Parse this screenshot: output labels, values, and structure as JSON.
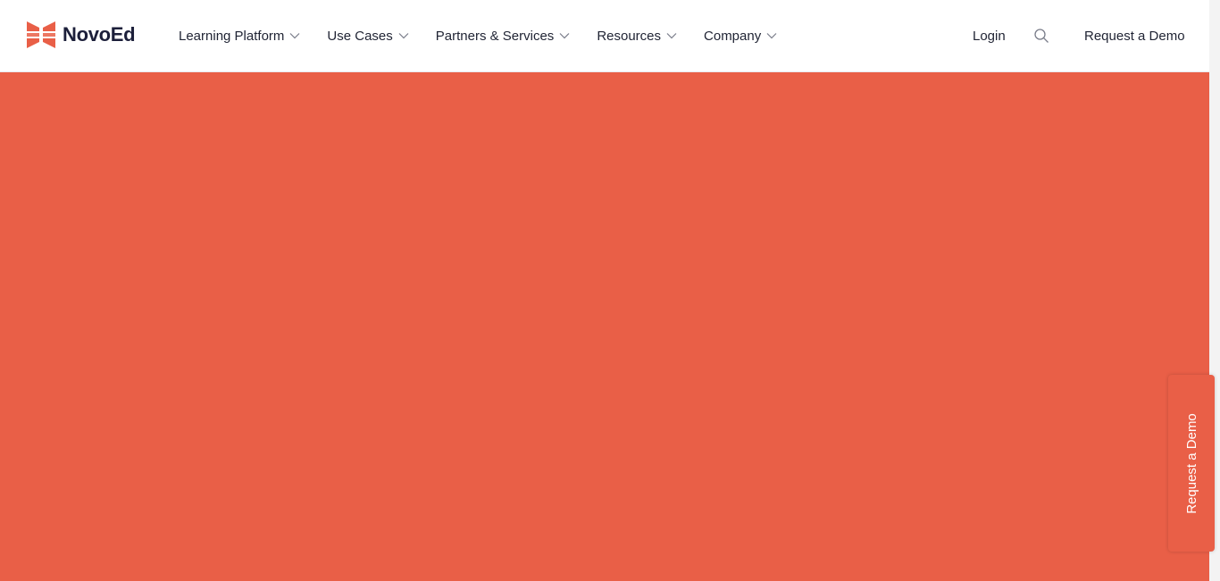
{
  "brand": {
    "name": "NovoEd",
    "accent_color": "#e95f47",
    "icon": "novoed-logo-icon"
  },
  "nav": {
    "items": [
      {
        "label": "Learning Platform",
        "icon": "chevron-down-icon"
      },
      {
        "label": "Use Cases",
        "icon": "chevron-down-icon"
      },
      {
        "label": "Partners & Services",
        "icon": "chevron-down-icon"
      },
      {
        "label": "Resources",
        "icon": "chevron-down-icon"
      },
      {
        "label": "Company",
        "icon": "chevron-down-icon"
      }
    ]
  },
  "header_right": {
    "login_label": "Login",
    "search_icon": "search-icon",
    "demo_label": "Request a Demo"
  },
  "side_tab": {
    "label": "Request a Demo"
  },
  "colors": {
    "hero_background": "#e95f47",
    "text": "#1f2333"
  }
}
